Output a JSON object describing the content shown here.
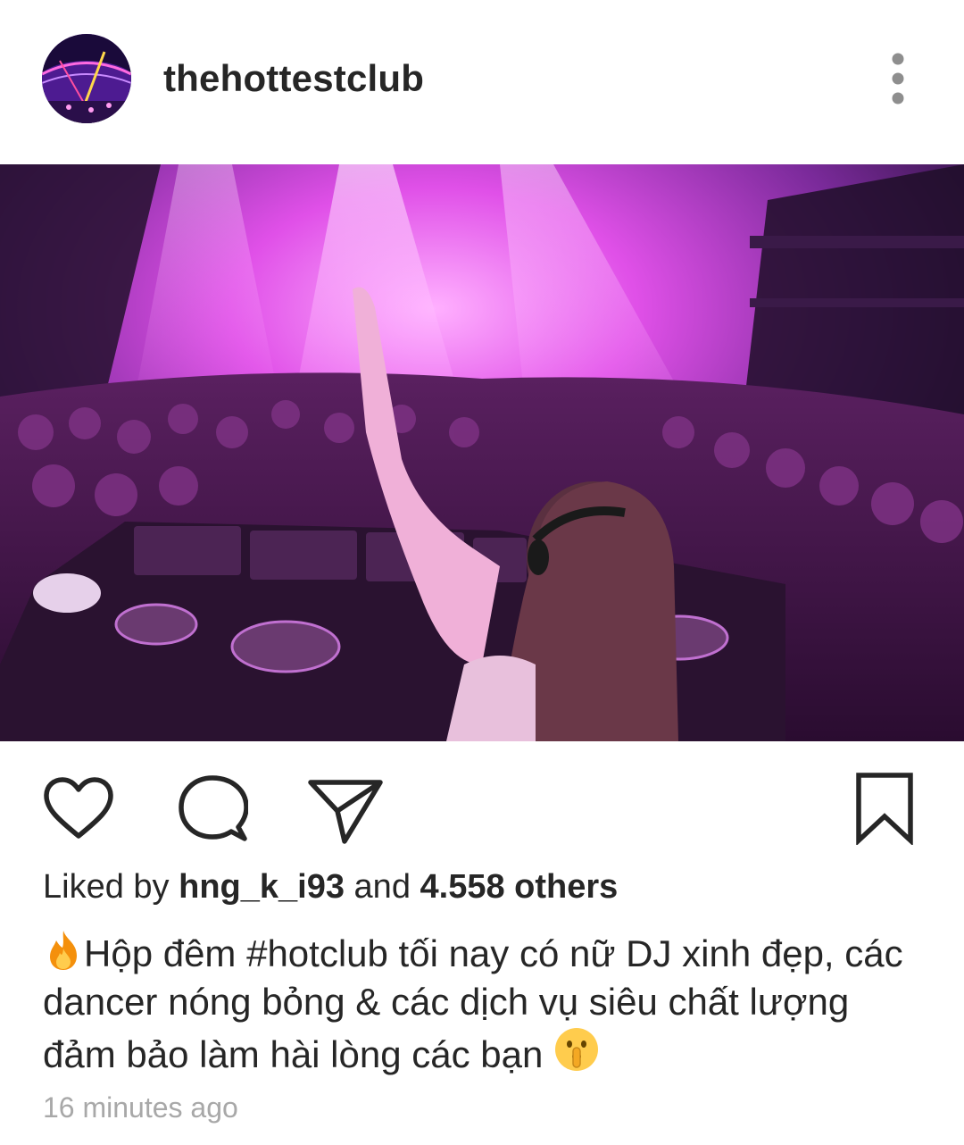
{
  "post": {
    "username": "thehottestclub",
    "likes": {
      "prefix": "Liked by",
      "user": "hng_k_i93",
      "joiner": "and",
      "count": "4.558 others"
    },
    "caption": {
      "lead_emoji": "fire-emoji",
      "text": "Hộp đêm #hotclub tối nay có nữ DJ xinh đẹp, các dancer nóng bỏng & các dịch vụ siêu chất lượng đảm bảo làm hài lòng các bạn",
      "trail_emoji": "shushing-face-emoji"
    },
    "timestamp": "16 minutes ago"
  },
  "colors": {
    "text": "#262626",
    "muted": "#a8a8a8",
    "photo_tint": "#e040e0"
  },
  "icons": [
    "more-vertical-icon",
    "heart-icon",
    "comment-icon",
    "share-icon",
    "bookmark-icon"
  ]
}
